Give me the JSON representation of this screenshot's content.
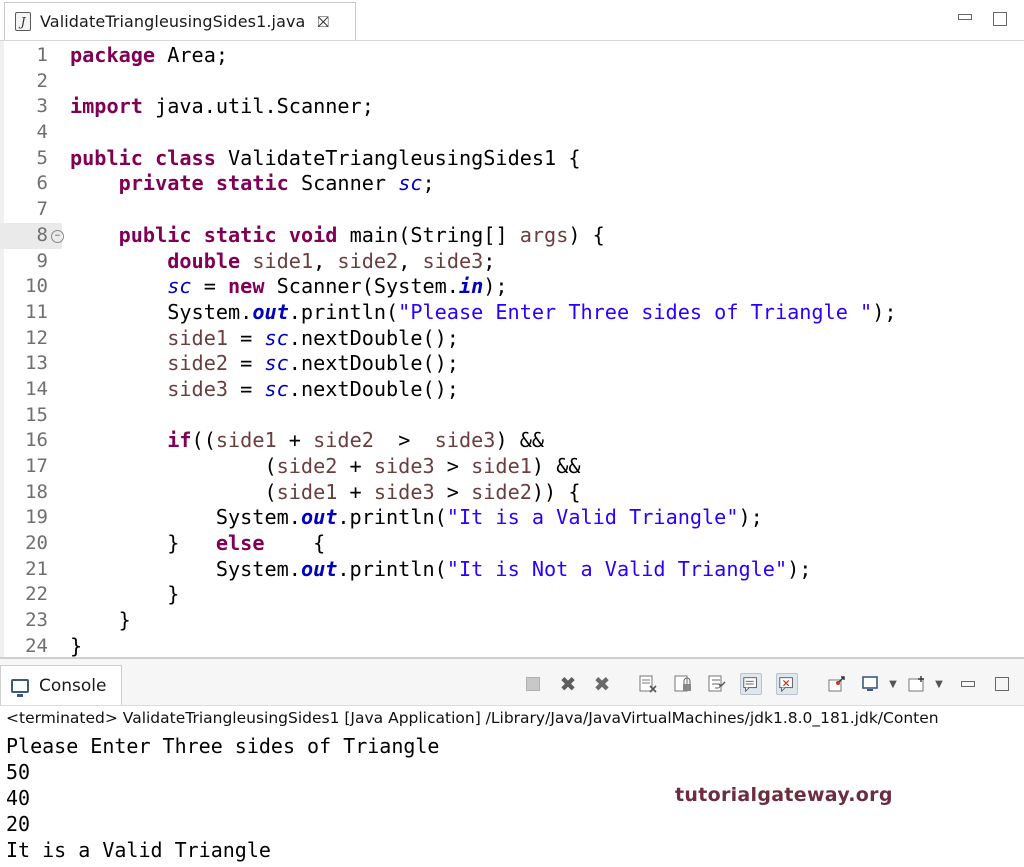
{
  "editor": {
    "tab_title": "ValidateTriangleusingSides1.java",
    "tab_icon": "java-file-icon",
    "close_glyph": "⛝",
    "line_numbers": [
      "1",
      "2",
      "3",
      "4",
      "5",
      "6",
      "7",
      "8",
      "9",
      "10",
      "11",
      "12",
      "13",
      "14",
      "15",
      "16",
      "17",
      "18",
      "19",
      "20",
      "21",
      "22",
      "23",
      "24"
    ],
    "colors": {
      "keyword": "#7f0055",
      "string": "#2a00ff",
      "field": "#0000c0",
      "variable": "#6a3e3e"
    }
  },
  "code": {
    "l1": [
      "package",
      " Area;"
    ],
    "l3": [
      "import",
      " java.util.Scanner;"
    ],
    "l5": [
      "public",
      " ",
      "class",
      " ValidateTriangleusingSides1 {"
    ],
    "l6": [
      "    ",
      "private",
      " ",
      "static",
      " Scanner ",
      "sc",
      ";"
    ],
    "l8": [
      "    ",
      "public",
      " ",
      "static",
      " ",
      "void",
      " main(String[] ",
      "args",
      ") {"
    ],
    "l9": [
      "        ",
      "double",
      " ",
      "side1",
      ", ",
      "side2",
      ", ",
      "side3",
      ";"
    ],
    "l10": [
      "        ",
      "sc",
      " = ",
      "new",
      " Scanner(System.",
      "in",
      ");"
    ],
    "l11": [
      "        System.",
      "out",
      ".println(",
      "\"Please Enter Three sides of Triangle \"",
      ");"
    ],
    "l12": [
      "        ",
      "side1",
      " = ",
      "sc",
      ".nextDouble();"
    ],
    "l13": [
      "        ",
      "side2",
      " = ",
      "sc",
      ".nextDouble();"
    ],
    "l14": [
      "        ",
      "side3",
      " = ",
      "sc",
      ".nextDouble();"
    ],
    "l16": [
      "        ",
      "if",
      "((",
      "side1",
      " + ",
      "side2",
      "  >  ",
      "side3",
      ") &&"
    ],
    "l17": [
      "                (",
      "side2",
      " + ",
      "side3",
      " > ",
      "side1",
      ") &&"
    ],
    "l18": [
      "                (",
      "side1",
      " + ",
      "side3",
      " > ",
      "side2",
      ")) {"
    ],
    "l19": [
      "            System.",
      "out",
      ".println(",
      "\"It is a Valid Triangle\"",
      ");"
    ],
    "l20": [
      "        }   ",
      "else",
      "    {"
    ],
    "l21": [
      "            System.",
      "out",
      ".println(",
      "\"It is Not a Valid Triangle\"",
      ");"
    ],
    "l22": "        }",
    "l23": "    }",
    "l24": "}"
  },
  "console": {
    "tab_label": "Console",
    "status": "<terminated> ValidateTriangleusingSides1 [Java Application] /Library/Java/JavaVirtualMachines/jdk1.8.0_181.jdk/Conten",
    "output": [
      "Please Enter Three sides of Triangle",
      "50",
      "40",
      "20",
      "It is a Valid Triangle"
    ]
  },
  "watermark": "tutorialgateway.org"
}
